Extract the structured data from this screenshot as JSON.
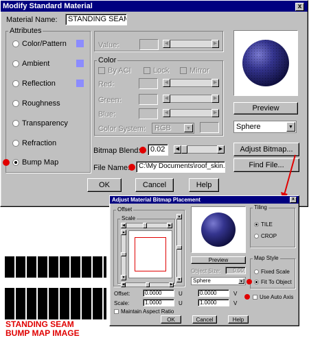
{
  "main_dialog": {
    "title": "Modify Standard Material",
    "close_label": "x",
    "material_name_label": "Material Name:",
    "material_name_value": "STANDING SEAM R",
    "attributes": {
      "label": "Attributes",
      "items": [
        {
          "label": "Color/Pattern",
          "selected": false
        },
        {
          "label": "Ambient",
          "selected": false
        },
        {
          "label": "Reflection",
          "selected": false
        },
        {
          "label": "Roughness",
          "selected": false
        },
        {
          "label": "Transparency",
          "selected": false
        },
        {
          "label": "Refraction",
          "selected": false
        },
        {
          "label": "Bump Map",
          "selected": true
        }
      ]
    },
    "value_label": "Value:",
    "color_group": {
      "label": "Color",
      "by_aci": "By ACI",
      "lock": "Lock",
      "mirror": "Mirror",
      "red": "Red:",
      "green": "Green:",
      "blue": "Blue:",
      "color_system": "Color System:",
      "color_system_value": "RGB"
    },
    "bitmap_blend_label": "Bitmap Blend:",
    "bitmap_blend_value": "0.02",
    "file_name_label": "File Name:",
    "file_name_value": "C:\\My Documents\\roof_skin.gif",
    "preview_button": "Preview",
    "preview_shape": "Sphere",
    "adjust_bitmap_button": "Adjust Bitmap...",
    "find_file_button": "Find File...",
    "ok_button": "OK",
    "cancel_button": "Cancel",
    "help_button": "Help"
  },
  "adjust_dialog": {
    "title": "Adjust Material Bitmap Placement",
    "close_label": "x",
    "offset_label": "Offset",
    "scale_label": "Scale",
    "tiling": {
      "label": "Tiling",
      "tile": "TILE",
      "crop": "CROP",
      "selected": "TILE"
    },
    "map_style": {
      "label": "Map Style",
      "fixed_scale": "Fixed Scale",
      "fit_to_object": "Fit To Object",
      "selected": "Fit To Object"
    },
    "preview_button": "Preview",
    "object_size_label": "Object Size:",
    "object_size_value": "0.00",
    "preview_shape": "Sphere",
    "use_auto_axis": "Use Auto Axis",
    "offset_row_label": "Offset:",
    "offset_u": "0.0000",
    "offset_v": "0.0000",
    "scale_row_label": "Scale:",
    "scale_u": "1.0000",
    "scale_v": "1.0000",
    "u_label": "U",
    "v_label": "V",
    "maintain_aspect": "Maintain Aspect Ratio",
    "ok_button": "OK",
    "cancel_button": "Cancel",
    "help_button": "Help"
  },
  "caption": {
    "line1": "STANDING SEAM",
    "line2": "BUMP MAP IMAGE"
  },
  "colors": {
    "titlebar": "#000080",
    "face": "#c0c0c0",
    "swatch": "#8c8cff",
    "marker": "#e00000",
    "sphere": "#2a2a7a"
  }
}
